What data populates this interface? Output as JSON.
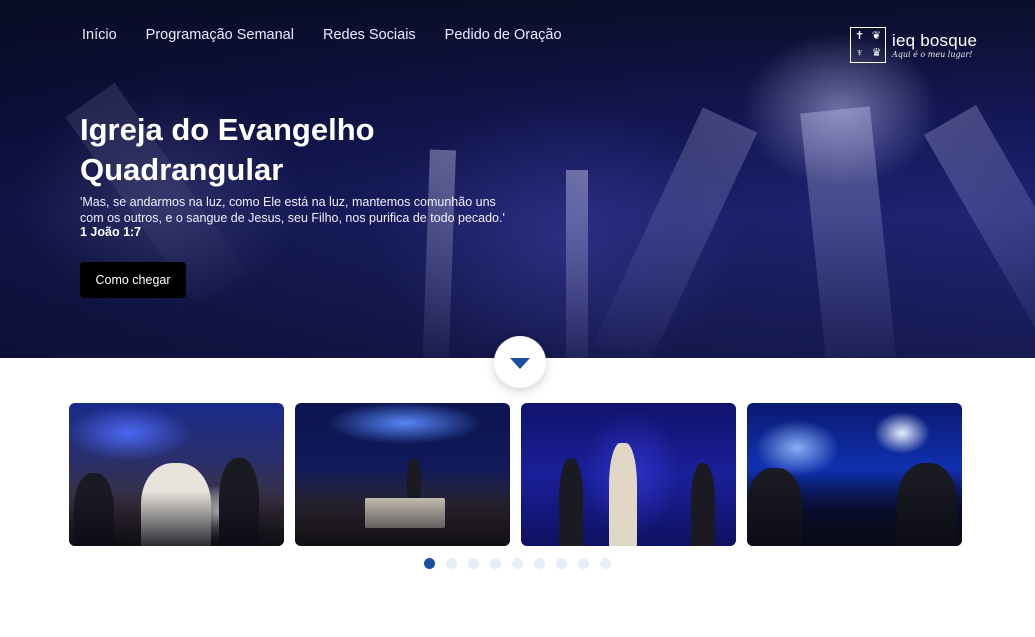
{
  "nav": {
    "items": [
      {
        "label": "Início"
      },
      {
        "label": "Programação Semanal"
      },
      {
        "label": "Redes Sociais"
      },
      {
        "label": "Pedido de Oração"
      }
    ]
  },
  "logo": {
    "name": "ieq bosque",
    "tagline": "Aqui é o meu lugar!",
    "icons": [
      "cross-icon",
      "dove-icon",
      "cup-icon",
      "crown-icon"
    ]
  },
  "hero": {
    "title_line1": "Igreja do Evangelho",
    "title_line2": "Quadrangular",
    "verse": "'Mas, se andarmos na luz, como Ele está na luz, mantemos comunhão uns com os outros, e o sangue de Jesus, seu Filho, nos purifica de todo pecado.'",
    "verse_ref": "1 João 1:7",
    "cta_label": "Como chegar"
  },
  "scroll_button": {
    "icon": "chevron-down-icon",
    "color": "#1c4fa0"
  },
  "gallery": {
    "slides_total": 9,
    "active_index": 0,
    "accent": "#1c4fa0"
  }
}
